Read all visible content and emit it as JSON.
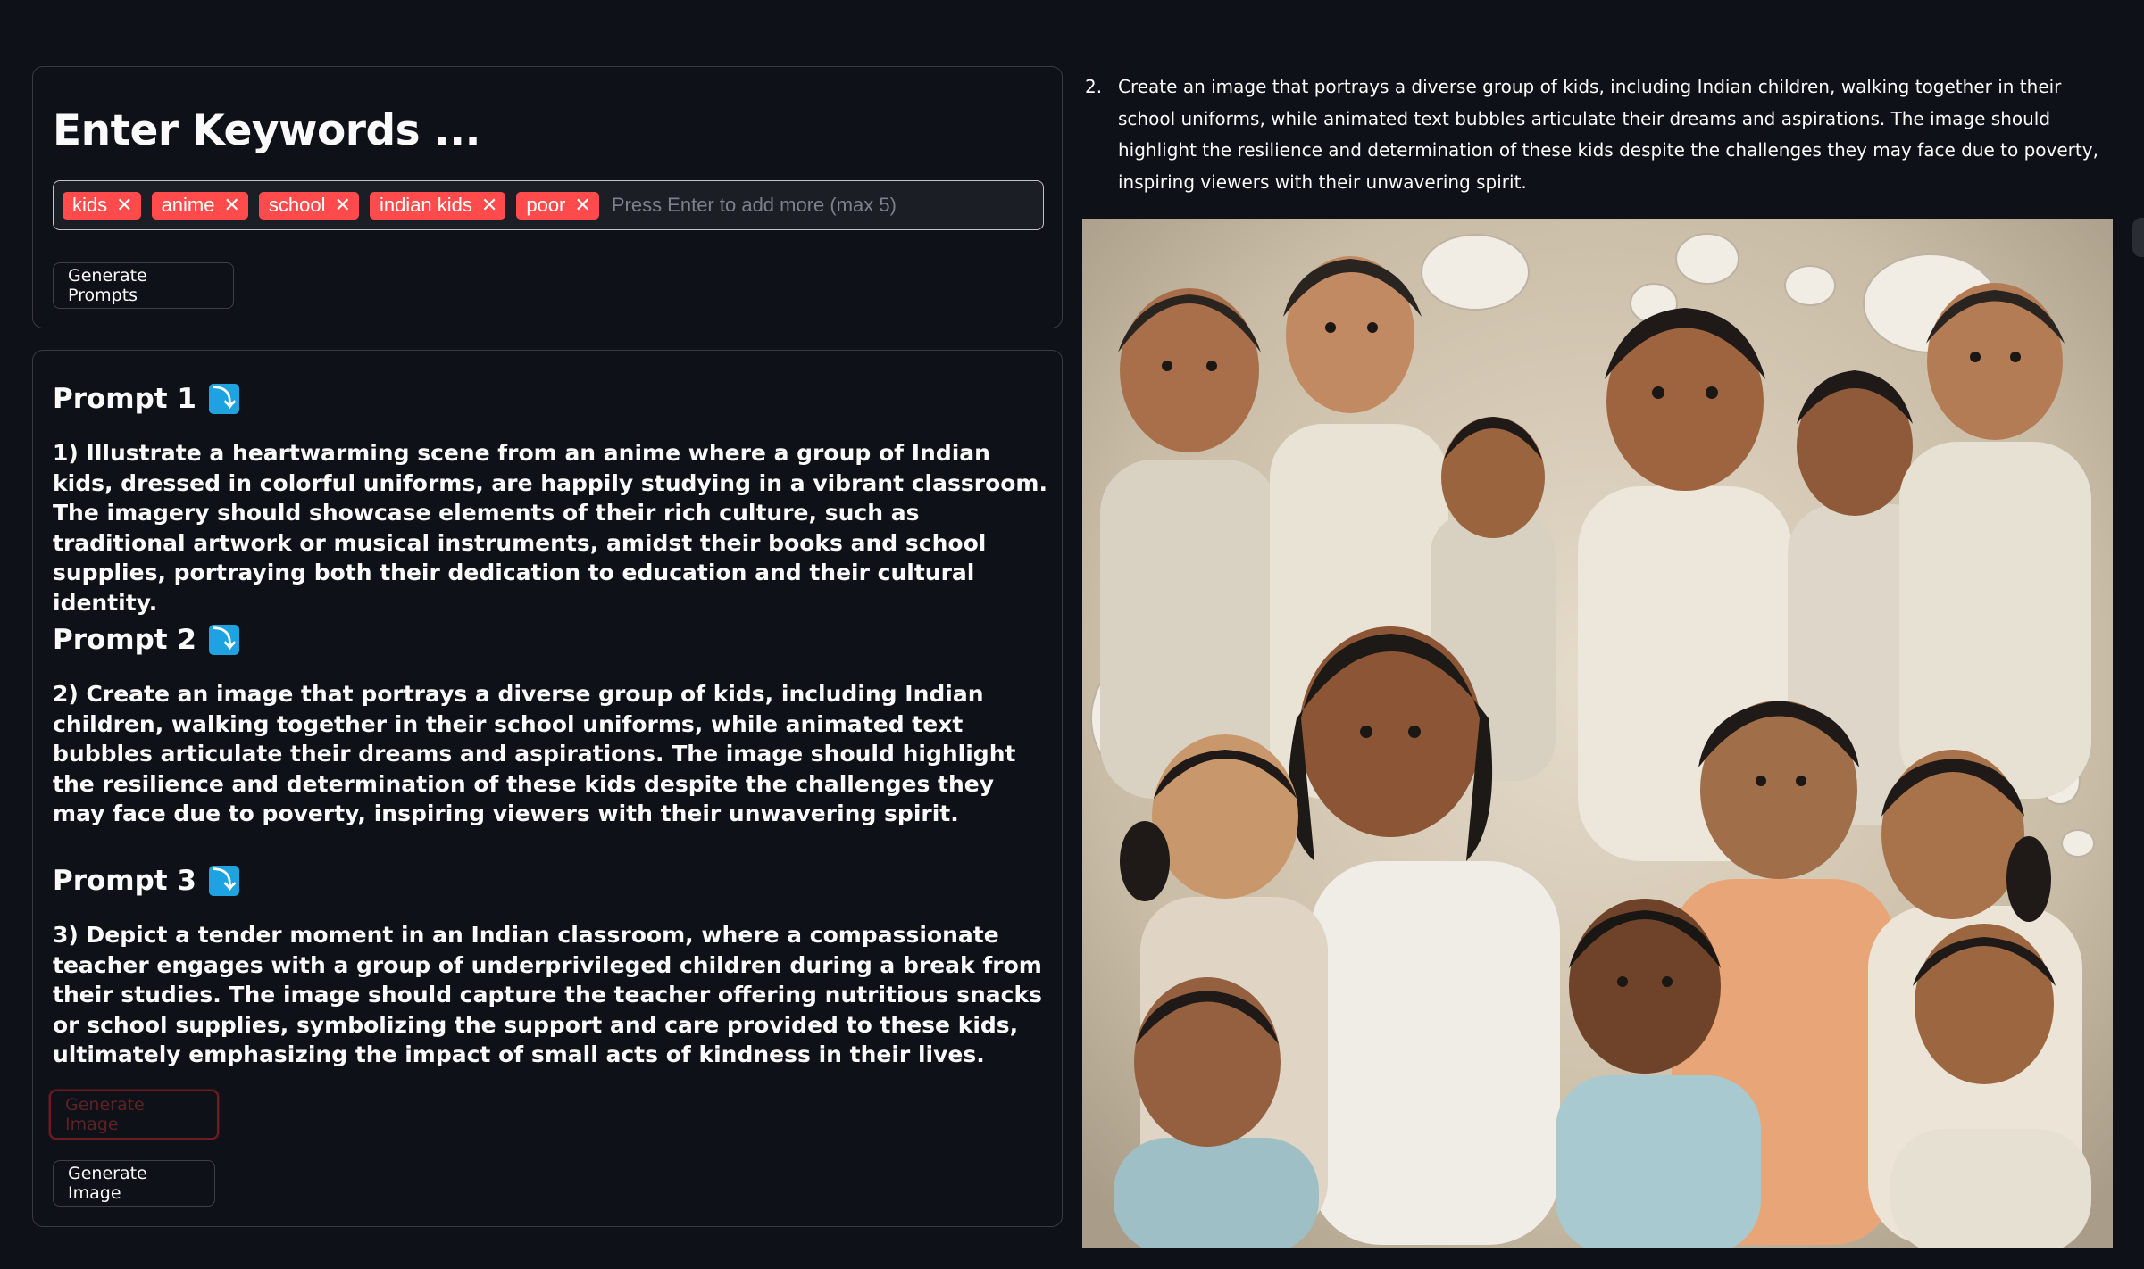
{
  "keywords": {
    "title": "Enter Keywords ...",
    "tags": [
      "kids",
      "anime",
      "school",
      "indian kids",
      "poor"
    ],
    "input_placeholder": "Press Enter to add more (max 5)",
    "generate_prompts_label": "Generate Prompts"
  },
  "prompts": [
    {
      "heading": "Prompt 1",
      "icon": "arrow-down-icon",
      "text": "1) Illustrate a heartwarming scene from an anime where a group of Indian kids, dressed in colorful uniforms, are happily studying in a vibrant classroom. The imagery should showcase elements of their rich culture, such as traditional artwork or musical instruments, amidst their books and school supplies, portraying both their dedication to education and their cultural identity."
    },
    {
      "heading": "Prompt 2",
      "icon": "arrow-down-icon",
      "text": "2) Create an image that portrays a diverse group of kids, including Indian children, walking together in their school uniforms, while animated text bubbles articulate their dreams and aspirations. The image should highlight the resilience and determination of these kids despite the challenges they may face due to poverty, inspiring viewers with their unwavering spirit."
    },
    {
      "heading": "Prompt 3",
      "icon": "arrow-down-icon",
      "text": "3) Depict a tender moment in an Indian classroom, where a compassionate teacher engages with a group of underprivileged children during a break from their studies. The image should capture the teacher offering nutritious snacks or school supplies, symbolizing the support and care provided to these kids, ultimately emphasizing the impact of small acts of kindness in their lives."
    }
  ],
  "buttons": {
    "generate_image_disabled": "Generate Image",
    "generate_image": "Generate Image"
  },
  "result": {
    "number": "2.",
    "caption": "Create an image that portrays a diverse group of kids, including Indian children, walking together in their school uniforms, while animated text bubbles articulate their dreams and aspirations. The image should highlight the resilience and determination of these kids despite the challenges they may face due to poverty, inspiring viewers with their unwavering spirit."
  },
  "colors": {
    "background": "#0e1117",
    "accent": "#ff4b4b",
    "icon_blue": "#1fa3e0",
    "disabled_border": "#6b1d22"
  }
}
